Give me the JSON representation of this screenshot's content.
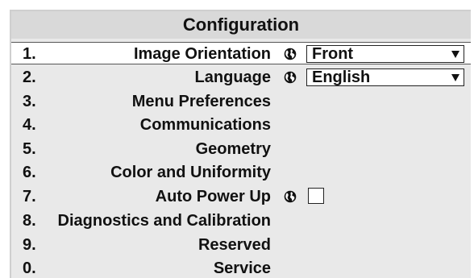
{
  "menu": {
    "title": "Configuration",
    "items": [
      {
        "number": "1.",
        "label": "Image Orientation",
        "has_globe": true,
        "control": "dropdown",
        "value": "Front",
        "selected": true
      },
      {
        "number": "2.",
        "label": "Language",
        "has_globe": true,
        "control": "dropdown",
        "value": "English",
        "selected": false
      },
      {
        "number": "3.",
        "label": "Menu Preferences"
      },
      {
        "number": "4.",
        "label": "Communications"
      },
      {
        "number": "5.",
        "label": "Geometry"
      },
      {
        "number": "6.",
        "label": "Color and Uniformity"
      },
      {
        "number": "7.",
        "label": "Auto Power Up",
        "has_globe": true,
        "control": "checkbox",
        "checked": false
      },
      {
        "number": "8.",
        "label": "Diagnostics and Calibration"
      },
      {
        "number": "9.",
        "label": "Reserved"
      },
      {
        "number": "0.",
        "label": "Service"
      }
    ]
  },
  "icons": {
    "globe": "globe-icon",
    "dropdown_arrow": "chevron-down-icon"
  }
}
